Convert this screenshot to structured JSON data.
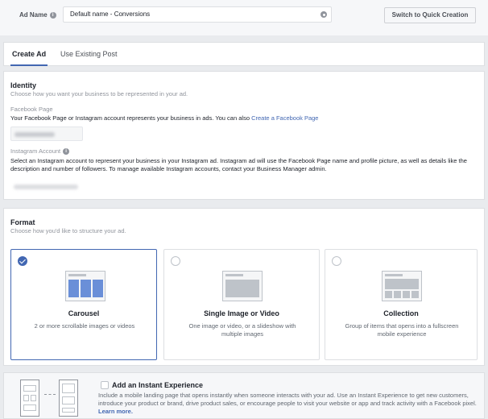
{
  "header": {
    "ad_name_label": "Ad Name",
    "ad_name_value": "Default name - Conversions",
    "quick_creation_label": "Switch to Quick Creation"
  },
  "tabs": [
    {
      "label": "Create Ad",
      "active": true
    },
    {
      "label": "Use Existing Post",
      "active": false
    }
  ],
  "identity": {
    "title": "Identity",
    "subtitle": "Choose how you want your business to be represented in your ad.",
    "facebook_page": {
      "label": "Facebook Page",
      "description": "Your Facebook Page or Instagram account represents your business in ads. You can also",
      "link": "Create a Facebook Page"
    },
    "instagram_account": {
      "label": "Instagram Account",
      "description": "Select an Instagram account to represent your business in your Instagram ad. Instagram ad will use the Facebook Page name and profile picture, as well as details like the description and number of followers. To manage available Instagram accounts, contact your Business Manager admin."
    }
  },
  "format": {
    "title": "Format",
    "subtitle": "Choose how you'd like to structure your ad.",
    "options": [
      {
        "title": "Carousel",
        "description": "2 or more scrollable images or videos",
        "selected": true
      },
      {
        "title": "Single Image or Video",
        "description": "One image or video, or a slideshow with multiple images",
        "selected": false
      },
      {
        "title": "Collection",
        "description": "Group of items that opens into a fullscreen mobile experience",
        "selected": false
      }
    ]
  },
  "instant_experience": {
    "title": "Add an Instant Experience",
    "description": "Include a mobile landing page that opens instantly when someone interacts with your ad. Use an Instant Experience to get new customers, introduce your product or brand, drive product sales, or encourage people to visit your website or app and track activity with a Facebook pixel.",
    "learn_more": "Learn more.",
    "checked": false
  },
  "colors": {
    "accent": "#4267b2",
    "background": "#e9ebee",
    "border": "#dddfe2",
    "muted_text": "#90949c"
  }
}
